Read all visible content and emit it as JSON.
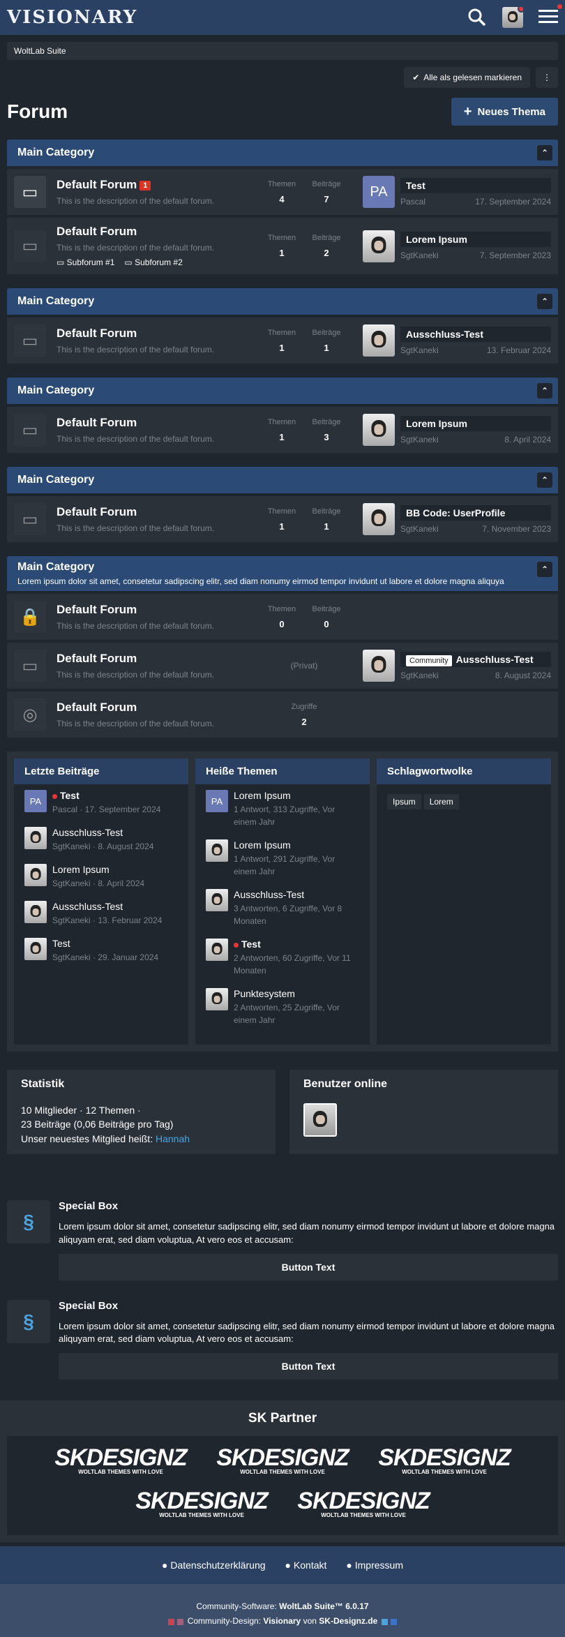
{
  "header": {
    "logo": "VISIONARY"
  },
  "breadcrumb": "WoltLab Suite",
  "mark_read": "Alle als gelesen markieren",
  "page_title": "Forum",
  "new_topic": "Neues Thema",
  "labels": {
    "themen": "Themen",
    "beitraege": "Beiträge",
    "zugriffe": "Zugriffe",
    "privat": "(Privat)"
  },
  "categories": [
    {
      "title": "Main Category",
      "boards": [
        {
          "name": "Default Forum",
          "badge": "1",
          "desc": "This is the description of the default forum.",
          "themen": "4",
          "beitraege": "7",
          "last_title": "Test",
          "last_user": "Pascal",
          "last_date": "17. September 2024",
          "avatar": "PA"
        },
        {
          "name": "Default Forum",
          "desc": "This is the description of the default forum.",
          "subs": [
            "Subforum #1",
            "Subforum #2"
          ],
          "themen": "1",
          "beitraege": "2",
          "last_title": "Lorem Ipsum",
          "last_user": "SgtKaneki",
          "last_date": "7. September 2023"
        }
      ]
    },
    {
      "title": "Main Category",
      "boards": [
        {
          "name": "Default Forum",
          "desc": "This is the description of the default forum.",
          "themen": "1",
          "beitraege": "1",
          "last_title": "Ausschluss-Test",
          "last_user": "SgtKaneki",
          "last_date": "13. Februar 2024"
        }
      ]
    },
    {
      "title": "Main Category",
      "boards": [
        {
          "name": "Default Forum",
          "desc": "This is the description of the default forum.",
          "themen": "1",
          "beitraege": "3",
          "last_title": "Lorem Ipsum",
          "last_user": "SgtKaneki",
          "last_date": "8. April 2024"
        }
      ]
    },
    {
      "title": "Main Category",
      "boards": [
        {
          "name": "Default Forum",
          "desc": "This is the description of the default forum.",
          "themen": "1",
          "beitraege": "1",
          "last_title": "BB Code: UserProfile",
          "last_user": "SgtKaneki",
          "last_date": "7. November 2023"
        }
      ]
    },
    {
      "title": "Main Category",
      "desc": "Lorem ipsum dolor sit amet, consetetur sadipscing elitr, sed diam nonumy eirmod tempor invidunt ut labore et dolore magna aliquya",
      "boards": [
        {
          "name": "Default Forum",
          "desc": "This is the description of the default forum.",
          "themen": "0",
          "beitraege": "0"
        },
        {
          "name": "Default Forum",
          "desc": "This is the description of the default forum.",
          "private": true,
          "pill": "Community",
          "last_title": "Ausschluss-Test",
          "last_user": "SgtKaneki",
          "last_date": "8. August 2024"
        },
        {
          "name": "Default Forum",
          "desc": "This is the description of the default forum.",
          "zugriffe": "2"
        }
      ]
    }
  ],
  "boxes": {
    "recent": {
      "title": "Letzte Beiträge",
      "items": [
        {
          "title": "Test",
          "meta": "Pascal · 17. September 2024",
          "avatar": "PA",
          "unread": true,
          "bold": true
        },
        {
          "title": "Ausschluss-Test",
          "meta": "SgtKaneki · 8. August 2024"
        },
        {
          "title": "Lorem Ipsum",
          "meta": "SgtKaneki · 8. April 2024"
        },
        {
          "title": "Ausschluss-Test",
          "meta": "SgtKaneki · 13. Februar 2024"
        },
        {
          "title": "Test",
          "meta": "SgtKaneki · 29. Januar 2024"
        }
      ]
    },
    "hot": {
      "title": "Heiße Themen",
      "items": [
        {
          "title": "Lorem Ipsum",
          "meta": "1 Antwort, 313 Zugriffe, Vor einem Jahr",
          "avatar": "PA"
        },
        {
          "title": "Lorem Ipsum",
          "meta": "1 Antwort, 291 Zugriffe, Vor einem Jahr"
        },
        {
          "title": "Ausschluss-Test",
          "meta": "3 Antworten, 6 Zugriffe, Vor 8 Monaten"
        },
        {
          "title": "Test",
          "meta": "2 Antworten, 60 Zugriffe, Vor 11 Monaten",
          "unread": true,
          "bold": true
        },
        {
          "title": "Punktesystem",
          "meta": "2 Antworten, 25 Zugriffe, Vor einem Jahr"
        }
      ]
    },
    "tags": {
      "title": "Schlagwortwolke",
      "items": [
        "Ipsum",
        "Lorem"
      ]
    }
  },
  "statistics": {
    "title": "Statistik",
    "line1": "10 Mitglieder · 12 Themen ·",
    "line2": "23 Beiträge (0,06 Beiträge pro Tag)",
    "line3": "Unser neuestes Mitglied heißt:",
    "newest": "Hannah",
    "link_color": "#4aa3df"
  },
  "online": {
    "title": "Benutzer online"
  },
  "special": [
    {
      "title": "Special Box",
      "text": "Lorem ipsum dolor sit amet, consetetur sadipscing elitr, sed diam nonumy eirmod tempor invidunt ut labore et dolore magna aliquyam erat, sed diam voluptua, At vero eos et accusam:",
      "button": "Button Text"
    },
    {
      "title": "Special Box",
      "text": "Lorem ipsum dolor sit amet, consetetur sadipscing elitr, sed diam nonumy eirmod tempor invidunt ut labore et dolore magna aliquyam erat, sed diam voluptua, At vero eos et accusam:",
      "button": "Button Text"
    }
  ],
  "partner": {
    "title": "SK Partner",
    "logo_big": "SKDESIGNZ",
    "logo_small": "WOLTLAB THEMES WITH LOVE",
    "count": 5
  },
  "footer": {
    "links": [
      "Datenschutzerklärung",
      "Kontakt",
      "Impressum"
    ],
    "software_prefix": "Community-Software:",
    "software": "WoltLab Suite™ 6.0.17",
    "design_prefix": "Community-Design:",
    "design": "Visionary",
    "von": "von",
    "design_by": "SK-Designz.de"
  }
}
